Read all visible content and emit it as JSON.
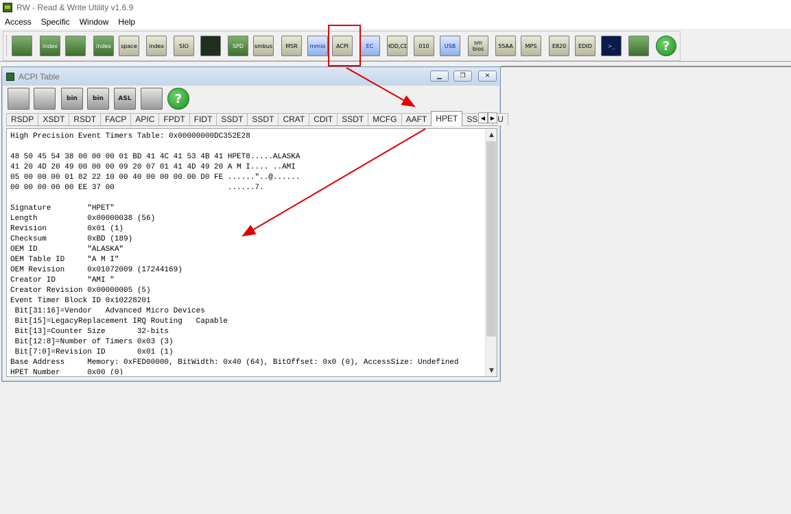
{
  "app": {
    "title": "RW - Read & Write Utility v1.6.9"
  },
  "menu": [
    {
      "key": "access",
      "label": "Access"
    },
    {
      "key": "specific",
      "label": "Specific"
    },
    {
      "key": "window",
      "label": "Window"
    },
    {
      "key": "help",
      "label": "Help"
    }
  ],
  "toolbar": [
    {
      "key": "pci",
      "label": "",
      "icon": "pci-card-icon",
      "style": "green"
    },
    {
      "key": "pci-index",
      "label": "index",
      "icon": "pci-index-icon",
      "style": "green"
    },
    {
      "key": "memory",
      "label": "",
      "icon": "memory-icon",
      "style": "green"
    },
    {
      "key": "memory-index",
      "label": "index",
      "icon": "memory-index-icon",
      "style": "green"
    },
    {
      "key": "io-space",
      "label": "space",
      "icon": "io-space-icon",
      "style": ""
    },
    {
      "key": "io-index",
      "label": "index",
      "icon": "io-index-icon",
      "style": ""
    },
    {
      "key": "sio",
      "label": "SIO",
      "icon": "sio-icon",
      "style": ""
    },
    {
      "key": "oscilloscope",
      "label": "",
      "icon": "oscilloscope-icon",
      "style": "dark"
    },
    {
      "key": "spd",
      "label": "SPD",
      "icon": "spd-icon",
      "style": "green"
    },
    {
      "key": "smbus",
      "label": "smbus",
      "icon": "smbus-icon",
      "style": ""
    },
    {
      "key": "msr",
      "label": "MSR",
      "icon": "msr-icon",
      "style": ""
    },
    {
      "key": "mmio",
      "label": "mmio",
      "icon": "mmio-icon",
      "style": "blue"
    },
    {
      "key": "acpi",
      "label": "ACPI",
      "icon": "acpi-icon",
      "style": ""
    },
    {
      "key": "ec",
      "label": "EC",
      "icon": "ec-icon",
      "style": "blue"
    },
    {
      "key": "hdd-cd",
      "label": "HDD,CD",
      "icon": "disk-icon",
      "style": ""
    },
    {
      "key": "dump",
      "label": "010",
      "icon": "dump-icon",
      "style": ""
    },
    {
      "key": "usb",
      "label": "USB",
      "icon": "usb-icon",
      "style": "blue"
    },
    {
      "key": "smbios",
      "label": "sm bios",
      "icon": "smbios-icon",
      "style": ""
    },
    {
      "key": "55aa",
      "label": "55AA",
      "icon": "option-rom-icon",
      "style": ""
    },
    {
      "key": "mps",
      "label": "MPS",
      "icon": "mps-icon",
      "style": ""
    },
    {
      "key": "e820",
      "label": "E820",
      "icon": "e820-icon",
      "style": ""
    },
    {
      "key": "edid",
      "label": "EDID",
      "icon": "edid-icon",
      "style": ""
    },
    {
      "key": "command",
      "label": ">_",
      "icon": "terminal-icon",
      "style": "term"
    },
    {
      "key": "tools",
      "label": "",
      "icon": "tools-icon",
      "style": "green"
    },
    {
      "key": "help",
      "label": "?",
      "icon": "help-icon",
      "style": "help"
    }
  ],
  "child_window": {
    "title": "ACPI Table",
    "buttons": [
      {
        "key": "save",
        "label": "",
        "icon": "save-icon"
      },
      {
        "key": "save-all",
        "label": "",
        "icon": "save-all-icon"
      },
      {
        "key": "save-bin",
        "label": "bin",
        "icon": "save-bin-icon"
      },
      {
        "key": "save-all-bin",
        "label": "bin",
        "icon": "save-all-bin-icon"
      },
      {
        "key": "asl",
        "label": "ASL",
        "icon": "asl-icon"
      },
      {
        "key": "find",
        "label": "",
        "icon": "binoculars-icon"
      },
      {
        "key": "help",
        "label": "?",
        "icon": "help-icon"
      }
    ],
    "tabs": [
      "RSDP",
      "XSDT",
      "RSDT",
      "FACP",
      "APIC",
      "FPDT",
      "FIDT",
      "SSDT",
      "SSDT",
      "CRAT",
      "CDIT",
      "SSDT",
      "MCFG",
      "AAFT",
      "HPET",
      "SSDT",
      "U"
    ],
    "active_tab_index": 14,
    "content_lines": [
      "High Precision Event Timers Table: 0x00000000DC352E28",
      "",
      "48 50 45 54 38 00 00 00 01 BD 41 4C 41 53 4B 41 HPET8.....ALASKA",
      "41 20 4D 20 49 00 00 00 09 20 07 01 41 4D 49 20 A M I.... ..AMI",
      "05 00 00 00 01 82 22 10 00 40 00 00 00 00 D0 FE ......\"..@......",
      "00 00 00 00 00 EE 37 00                         ......7.",
      "",
      "Signature        \"HPET\"",
      "Length           0x00000038 (56)",
      "Revision         0x01 (1)",
      "Checksum         0xBD (189)",
      "OEM ID           \"ALASKA\"",
      "OEM Table ID     \"A M I\"",
      "OEM Revision     0x01072009 (17244169)",
      "Creator ID       \"AMI \"",
      "Creator Revision 0x00000005 (5)",
      "Event Timer Block ID 0x10228201",
      " Bit[31:16]=Vendor   Advanced Micro Devices",
      " Bit[15]=LegacyReplacement IRQ Routing   Capable",
      " Bit[13]=Counter Size       32-bits",
      " Bit[12:8]=Number of Timers 0x03 (3)",
      " Bit[7:0]=Revision ID       0x01 (1)",
      "Base Address     Memory: 0xFED00000, BitWidth: 0x40 (64), BitOffset: 0x0 (0), AccessSize: Undefined",
      "HPET Number      0x00 (0)"
    ]
  }
}
